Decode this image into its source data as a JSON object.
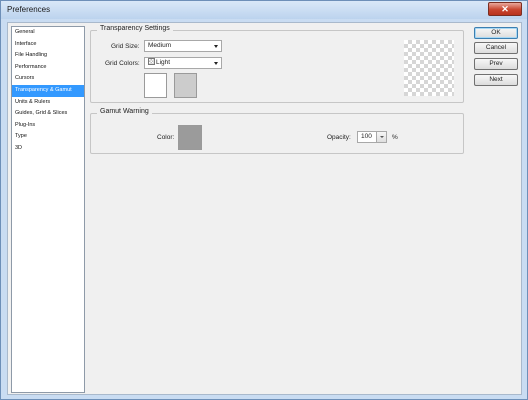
{
  "window": {
    "title": "Preferences",
    "close_glyph": "✕"
  },
  "sidebar": {
    "items": [
      {
        "label": "General",
        "selected": false
      },
      {
        "label": "Interface",
        "selected": false
      },
      {
        "label": "File Handling",
        "selected": false
      },
      {
        "label": "Performance",
        "selected": false
      },
      {
        "label": "Cursors",
        "selected": false
      },
      {
        "label": "Transparency & Gamut",
        "selected": true
      },
      {
        "label": "Units & Rulers",
        "selected": false
      },
      {
        "label": "Guides, Grid & Slices",
        "selected": false
      },
      {
        "label": "Plug-Ins",
        "selected": false
      },
      {
        "label": "Type",
        "selected": false
      },
      {
        "label": "3D",
        "selected": false
      }
    ]
  },
  "transparency": {
    "title": "Transparency Settings",
    "grid_size_label": "Grid Size:",
    "grid_size_value": "Medium",
    "grid_colors_label": "Grid Colors:",
    "grid_colors_value": "Light",
    "swatch_1_color": "#ffffff",
    "swatch_2_color": "#cccccc"
  },
  "gamut": {
    "title": "Gamut Warning",
    "color_label": "Color:",
    "color_value": "#9b9b9b",
    "opacity_label": "Opacity:",
    "opacity_value": "100",
    "opacity_unit": "%"
  },
  "buttons": {
    "ok": "OK",
    "cancel": "Cancel",
    "prev": "Prev",
    "next": "Next"
  },
  "colors": {
    "selection": "#3399ff",
    "title_bar": "#c9dcf2",
    "dialog_bg": "#f0f0f0"
  }
}
